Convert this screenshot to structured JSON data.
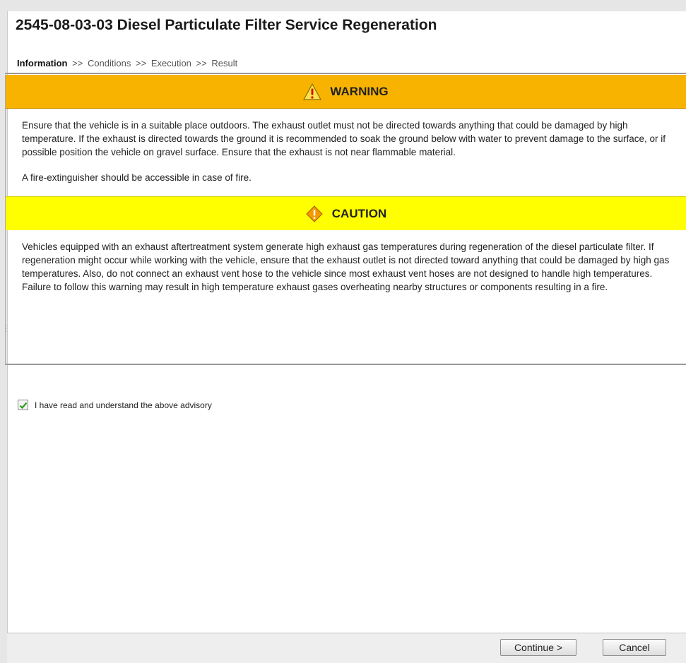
{
  "title": "2545-08-03-03 Diesel Particulate Filter Service Regeneration",
  "steps": {
    "current": "Information",
    "separator": ">>",
    "items": [
      "Conditions",
      "Execution",
      "Result"
    ]
  },
  "warning": {
    "heading": "WARNING",
    "color": "#f7b300",
    "icon": "warning-triangle-icon",
    "paragraphs": [
      "Ensure that the vehicle is in a suitable place outdoors. The exhaust outlet must not be directed towards anything that could be damaged by high temperature. If the exhaust is directed towards the ground it is recommended to soak the ground below with water to prevent damage to the surface, or if possible position the vehicle on gravel surface. Ensure that the exhaust is not near flammable material.",
      "A fire-extinguisher should be accessible in case of fire."
    ]
  },
  "caution": {
    "heading": "CAUTION",
    "color": "#ffff00",
    "icon": "caution-diamond-icon",
    "paragraphs": [
      "Vehicles equipped with an exhaust aftertreatment system generate high exhaust gas temperatures during regeneration of the diesel particulate filter. If regeneration might occur while working with the vehicle, ensure that the exhaust outlet is not directed toward anything that could be damaged by high gas temperatures. Also, do not connect an exhaust vent hose to the vehicle since most exhaust vent hoses are not designed to handle high temperatures. Failure to follow this warning may result in high temperature exhaust gases overheating nearby structures or components resulting in a fire."
    ]
  },
  "acknowledge": {
    "label": "I have read and understand the above advisory",
    "checked": true
  },
  "buttons": {
    "continue": "Continue >",
    "cancel": "Cancel"
  }
}
